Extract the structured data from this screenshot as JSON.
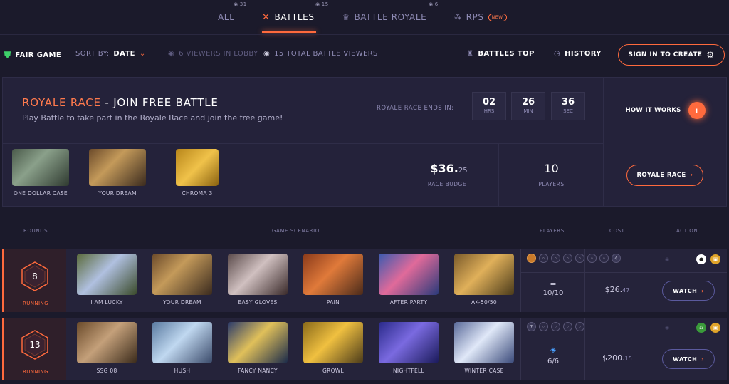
{
  "tabs": [
    {
      "label": "ALL",
      "count": "31"
    },
    {
      "label": "BATTLES",
      "count": ""
    },
    {
      "label": "BATTLE ROYALE",
      "count": "15"
    },
    {
      "label": "RPS",
      "count": "6",
      "badge": "NEW"
    }
  ],
  "toolbar": {
    "fair_game": "FAIR GAME",
    "sort_label": "SORT BY:",
    "sort_value": "DATE",
    "viewers_lobby": "6 VIEWERS IN LOBBY",
    "total_viewers": "15 TOTAL BATTLE VIEWERS",
    "battles_top": "BATTLES TOP",
    "history": "HISTORY",
    "sign_in": "SIGN IN TO CREATE"
  },
  "royale": {
    "title_highlight": "ROYALE RACE",
    "title_rest": " - JOIN FREE BATTLE",
    "subtitle": "Play Battle to take part in the Royale Race and join the free game!",
    "ends_label": "ROYALE RACE ENDS IN:",
    "timer": [
      {
        "value": "02",
        "unit": "HRS"
      },
      {
        "value": "26",
        "unit": "MIN"
      },
      {
        "value": "36",
        "unit": "SEC"
      }
    ],
    "how_it_works": "HOW IT WORKS",
    "cases": [
      "ONE DOLLAR CASE",
      "YOUR DREAM",
      "CHROMA 3"
    ],
    "budget_main": "$36.",
    "budget_cents": "25",
    "budget_label": "RACE BUDGET",
    "players_value": "10",
    "players_label": "PLAYERS",
    "button": "ROYALE RACE"
  },
  "table_header": {
    "rounds": "ROUNDS",
    "scenario": "GAME SCENARIO",
    "players": "PLAYERS",
    "cost": "COST",
    "action": "ACTION"
  },
  "battles": [
    {
      "rounds": "8",
      "status": "RUNNING",
      "cases": [
        "I AM LUCKY",
        "YOUR DREAM",
        "EASY GLOVES",
        "PAIN",
        "AFTER PARTY",
        "AK-50/50"
      ],
      "seat_badge": "4",
      "players": "10/10",
      "cost_main": "$26.",
      "cost_cents": "47",
      "action": "WATCH"
    },
    {
      "rounds": "13",
      "status": "RUNNING",
      "cases": [
        "SSG 08",
        "HUSH",
        "FANCY NANCY",
        "GROWL",
        "NIGHTFELL",
        "WINTER CASE"
      ],
      "seat_badge": "?",
      "players": "6/6",
      "cost_main": "$200.",
      "cost_cents": "15",
      "action": "WATCH"
    }
  ],
  "colors": {
    "accent": "#ff6a3d",
    "background": "#1b1a2b",
    "panel": "#24223a"
  }
}
